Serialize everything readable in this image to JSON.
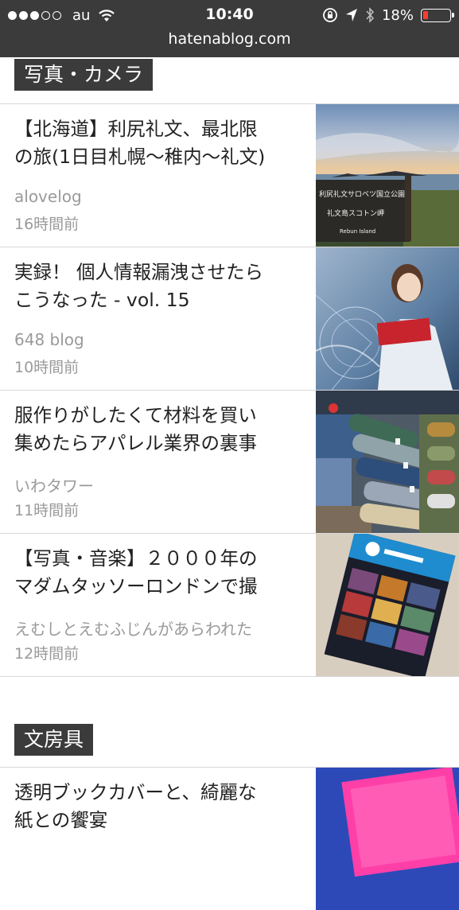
{
  "statusbar": {
    "carrier": "au",
    "time": "10:40",
    "battery_percent": "18%",
    "battery_level": 0.18,
    "url": "hatenablog.com"
  },
  "sections": [
    {
      "label": "写真・カメラ",
      "entries": [
        {
          "title": "【北海道】利尻礼文、最北限\nの旅(1日目札幌〜稚内〜礼文)",
          "author": "alovelog",
          "time": "16時間前"
        },
        {
          "title": "実録！ 個人情報漏洩させたら\nこうなった - vol. 15",
          "author": "648 blog",
          "time": "10時間前"
        },
        {
          "title": "服作りがしたくて材料を買い\n集めたらアパレル業界の裏事",
          "author": "いわタワー",
          "time": "11時間前"
        },
        {
          "title": "【写真・音楽】２０００年の\nマダムタッソーロンドンで撮",
          "author": "えむしとえむふじんがあらわれた",
          "time": "12時間前"
        }
      ]
    },
    {
      "label": "文房具",
      "entries": [
        {
          "title": "透明ブックカバーと、綺麗な\n紙との饗宴",
          "author": "",
          "time": ""
        }
      ]
    }
  ],
  "thumbnail_sign_text": {
    "line1": "利尻礼文サロベツ国立公園",
    "line2": "礼文島スコトン岬",
    "line3": "Rebun Island"
  }
}
